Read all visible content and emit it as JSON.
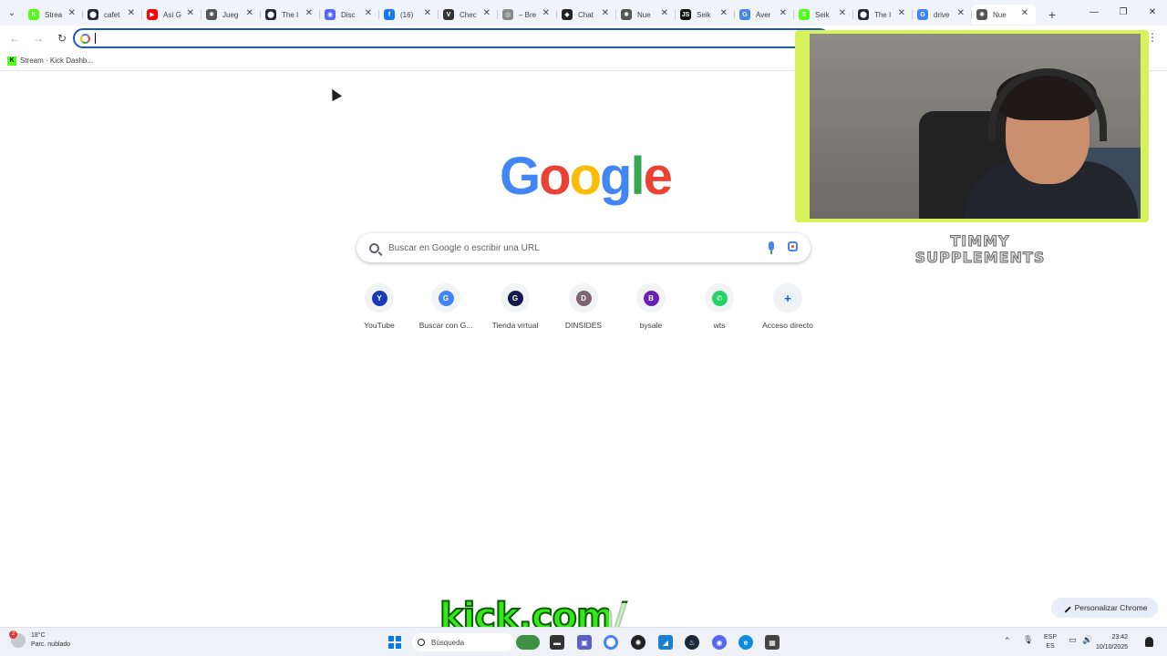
{
  "tabs": [
    {
      "label": "Strea",
      "icon": "kick-icon",
      "color": "#53fc18",
      "letter": "K"
    },
    {
      "label": "cafet",
      "icon": "github-icon",
      "color": "#24292f",
      "letter": "⬤"
    },
    {
      "label": "Así G",
      "icon": "youtube-icon",
      "color": "#ff0000",
      "letter": "▶"
    },
    {
      "label": "Jueg",
      "icon": "openai-icon",
      "color": "#555555",
      "letter": "✺"
    },
    {
      "label": "The I",
      "icon": "github-icon",
      "color": "#24292f",
      "letter": "⬤"
    },
    {
      "label": "Disc",
      "icon": "discord-icon",
      "color": "#5865f2",
      "letter": "◉"
    },
    {
      "label": "(16)",
      "icon": "facebook-icon",
      "color": "#1877f2",
      "letter": "f"
    },
    {
      "label": "Chec",
      "icon": "v-icon",
      "color": "#333333",
      "letter": "V"
    },
    {
      "label": "– Bre",
      "icon": "dot-icon",
      "color": "#8a8a8a",
      "letter": "◎"
    },
    {
      "label": "Chat",
      "icon": "chat-icon",
      "color": "#222222",
      "letter": "◆"
    },
    {
      "label": "Nue",
      "icon": "openai-icon",
      "color": "#555555",
      "letter": "✺"
    },
    {
      "label": "Seik",
      "icon": "js-icon",
      "color": "#111111",
      "letter": "JS"
    },
    {
      "label": "Aver",
      "icon": "google-icon",
      "color": "#4285f4",
      "letter": "G"
    },
    {
      "label": "Seik",
      "icon": "sheet-icon",
      "color": "#53fc18",
      "letter": "S"
    },
    {
      "label": "The I",
      "icon": "github-icon",
      "color": "#24292f",
      "letter": "⬤"
    },
    {
      "label": "drive",
      "icon": "google-icon",
      "color": "#4285f4",
      "letter": "G"
    },
    {
      "label": "Nue",
      "icon": "openai-icon",
      "color": "#555555",
      "letter": "✺",
      "active": true
    }
  ],
  "tab_close": "✕",
  "new_tab": "+",
  "window_controls": [
    "—",
    "❐",
    "✕"
  ],
  "bookmark": {
    "label": "Stream · Kick Dashb...",
    "icon": "kick-icon"
  },
  "google_logo": [
    "G",
    "o",
    "o",
    "g",
    "l",
    "e"
  ],
  "google_colors": [
    "#4285f4",
    "#ea4335",
    "#fbbc05",
    "#4285f4",
    "#34a853",
    "#ea4335"
  ],
  "search": {
    "placeholder": "Buscar en Google o escribir una URL"
  },
  "shortcuts": [
    {
      "label": "YouTube",
      "letter": "Y",
      "color": "#1a3bb5"
    },
    {
      "label": "Buscar con G...",
      "letter": "G",
      "color": "#4285f4"
    },
    {
      "label": "Tienda virtual",
      "letter": "G",
      "color": "#141a4a"
    },
    {
      "label": "DINSIDES",
      "letter": "D",
      "color": "#7a6570"
    },
    {
      "label": "bysale",
      "letter": "B",
      "color": "#6a1fb5"
    },
    {
      "label": "wts",
      "letter": "✆",
      "color": "#25d366"
    },
    {
      "label": "Acceso directo",
      "letter": "+",
      "color": "#e8f0fe"
    }
  ],
  "sponsor": {
    "line1": "TIMMY",
    "line2": "SUPPLEMENTS"
  },
  "kick_banner": "kick.com/",
  "customize_label": "Personalizar Chrome",
  "taskbar": {
    "weather_temp": "18°C",
    "weather_desc": "Parc. nublado",
    "weather_badge": "2",
    "search_label": "Búsqueda",
    "lang_top": "ESP",
    "lang_bottom": "ES",
    "time": "23:42",
    "date": "10/10/2025"
  }
}
